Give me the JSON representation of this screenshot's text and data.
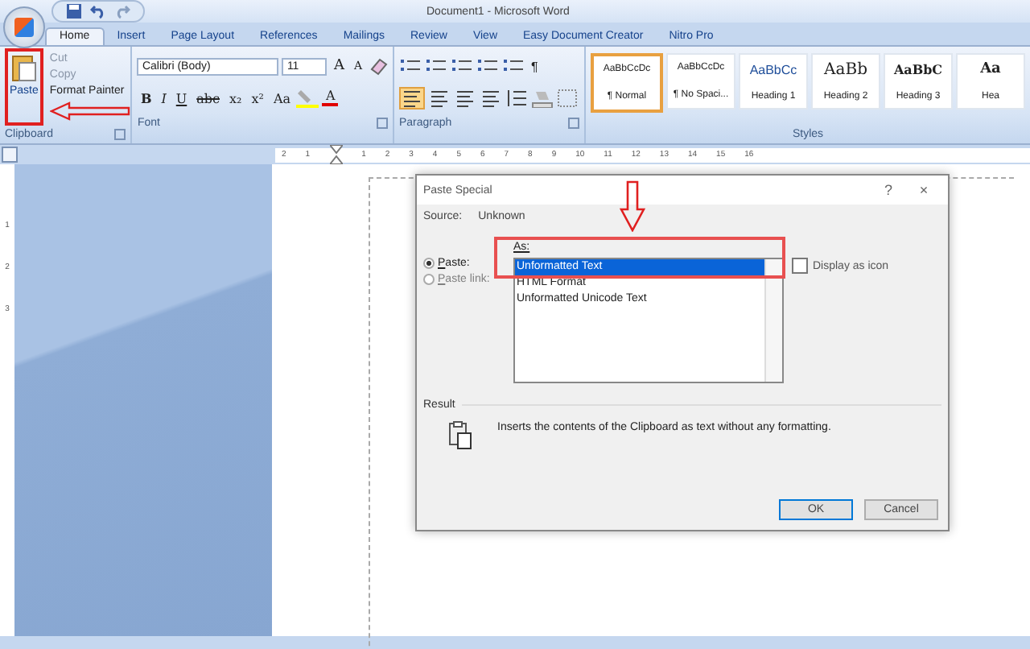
{
  "window": {
    "title": "Document1 - Microsoft Word"
  },
  "tabs": [
    {
      "label": "Home",
      "selected": true
    },
    {
      "label": "Insert",
      "selected": false
    },
    {
      "label": "Page Layout",
      "selected": false
    },
    {
      "label": "References",
      "selected": false
    },
    {
      "label": "Mailings",
      "selected": false
    },
    {
      "label": "Review",
      "selected": false
    },
    {
      "label": "View",
      "selected": false
    },
    {
      "label": "Easy Document Creator",
      "selected": false
    },
    {
      "label": "Nitro Pro",
      "selected": false
    }
  ],
  "clipboard": {
    "paste": "Paste",
    "items": [
      {
        "label": "Cut",
        "disabled": true
      },
      {
        "label": "Copy",
        "disabled": true
      },
      {
        "label": "Format Painter",
        "disabled": false
      }
    ],
    "group_label": "Clipboard"
  },
  "font": {
    "name": "Calibri (Body)",
    "size": "11",
    "size_buttons": [
      "A",
      "A"
    ],
    "format_buttons": [
      "B",
      "I",
      "U",
      "abc",
      "x₂",
      "x²",
      "Aa"
    ],
    "color_button": "A",
    "group_label": "Font"
  },
  "paragraph": {
    "pilcrow": "¶",
    "group_label": "Paragraph"
  },
  "styles": {
    "items": [
      {
        "preview": "AaBbCcDc",
        "name": "¶ Normal",
        "selected": true
      },
      {
        "preview": "AaBbCcDc",
        "name": "¶ No Spaci...",
        "selected": false
      },
      {
        "preview": "AaBbCc",
        "name": "Heading 1",
        "selected": false
      },
      {
        "preview": "AaBb",
        "name": "Heading 2",
        "selected": false
      },
      {
        "preview": "AaBbC",
        "name": "Heading 3",
        "selected": false
      },
      {
        "preview": "Aa",
        "name": "Hea",
        "selected": false
      }
    ],
    "group_label": "Styles"
  },
  "ruler": {
    "left_numbers": [
      "2",
      "1"
    ],
    "right_numbers": [
      "1",
      "2",
      "3",
      "4",
      "5",
      "6",
      "7",
      "8",
      "9",
      "10",
      "11",
      "12",
      "13",
      "14",
      "15",
      "16"
    ],
    "vertical_numbers": [
      "1",
      "2",
      "3"
    ]
  },
  "dialog": {
    "title": "Paste Special",
    "help": "?",
    "close": "×",
    "source_label": "Source:",
    "source_value": "Unknown",
    "as_label": "As:",
    "options": [
      {
        "label": "Paste:",
        "selected": true,
        "disabled": false
      },
      {
        "label": "Paste link:",
        "selected": false,
        "disabled": true
      }
    ],
    "formats": [
      {
        "label": "Unformatted Text",
        "selected": true
      },
      {
        "label": "HTML Format",
        "selected": false
      },
      {
        "label": "Unformatted Unicode Text",
        "selected": false
      }
    ],
    "display_as_icon": {
      "label": "Display as icon",
      "checked": false
    },
    "result_label": "Result",
    "result_text": "Inserts the contents of the Clipboard as text without any formatting.",
    "buttons": [
      "OK",
      "Cancel"
    ]
  }
}
